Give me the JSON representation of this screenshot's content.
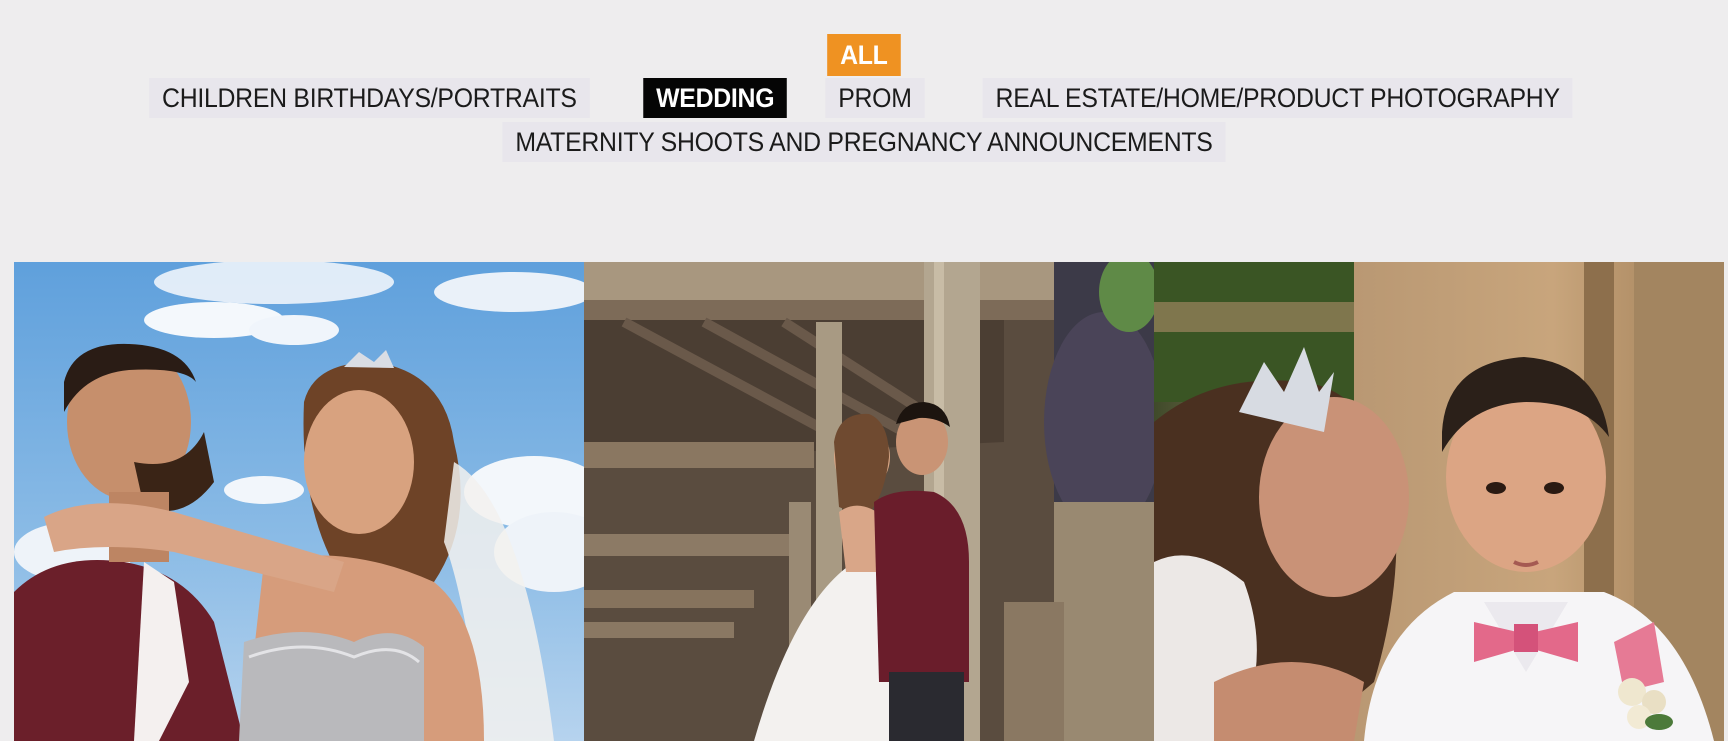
{
  "filters": {
    "row1": [
      {
        "label": "ALL",
        "state": "selected"
      }
    ],
    "row2": [
      {
        "label": "CHILDREN BIRTHDAYS/PORTRAITS",
        "state": "normal"
      },
      {
        "label": "WEDDING",
        "state": "active"
      },
      {
        "label": "PROM",
        "state": "normal"
      },
      {
        "label": "REAL ESTATE/HOME/PRODUCT PHOTOGRAPHY",
        "state": "normal"
      }
    ],
    "row3": [
      {
        "label": "MATERNITY SHOOTS AND PREGNANCY ANNOUNCEMENTS",
        "state": "normal"
      }
    ]
  },
  "colors": {
    "background": "#eeedee",
    "all_accent": "#ef9222",
    "active_bg": "#050505",
    "filter_bg": "#e8e6ec"
  },
  "gallery": {
    "photos": [
      {
        "subject": "couple-under-blue-sky"
      },
      {
        "subject": "couple-under-wooden-pavilion"
      },
      {
        "subject": "bride-kissing-boy-in-white-suit"
      }
    ]
  }
}
